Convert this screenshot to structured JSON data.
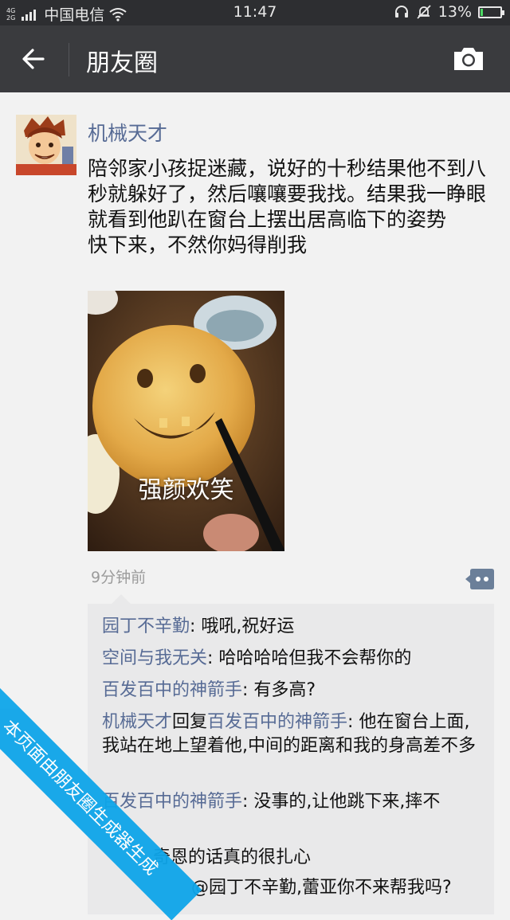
{
  "status_bar": {
    "network_top": "4G",
    "network_bottom": "2G",
    "carrier": "中国电信",
    "time": "11:47",
    "battery": "13%",
    "battery_level": 0.13,
    "icons": [
      "signal-icon",
      "wifi-icon",
      "headset-icon",
      "mute-bell-icon",
      "battery-icon"
    ]
  },
  "nav": {
    "title": "朋友圈",
    "back_icon": "back-arrow-icon",
    "camera_icon": "camera-icon"
  },
  "post": {
    "author": "机械天才",
    "text": "陪邻家小孩捉迷藏，说好的十秒结果他不到八秒就躲好了，然后嚷嚷要我找。结果我一睁眼就看到他趴在窗台上摆出居高临下的姿势\n快下来，不然你妈得削我",
    "image_caption": "强颜欢笑",
    "time": "9分钟前"
  },
  "comments": [
    {
      "name": "园丁不辛勤",
      "sep": ": ",
      "text": "哦吼,祝好运"
    },
    {
      "name": "空间与我无关",
      "sep": ": ",
      "text": "哈哈哈哈但我不会帮你的"
    },
    {
      "name": "百发百中的神箭手",
      "sep": ": ",
      "text": "有多高?"
    },
    {
      "name": "机械天才",
      "reply_word": "回复",
      "reply_to": "百发百中的神箭手",
      "sep": ": ",
      "text": "他在窗台上面,我站在地上望着他,中间的距离和我的身高差不多"
    },
    {
      "name": "百发百中的神箭手",
      "sep": ": ",
      "text": "没事的,让他跳下来,摔不"
    },
    {
      "text": "奇恩的话真的很扎心"
    },
    {
      "text": "@园丁不辛勤,蕾亚你不来帮我吗?"
    }
  ],
  "watermark": "本页面由朋友圈生成器生成",
  "colors": {
    "link_name": "#576b95",
    "ribbon": "#0ea5e9",
    "nav_bg": "#3a3b3e"
  }
}
